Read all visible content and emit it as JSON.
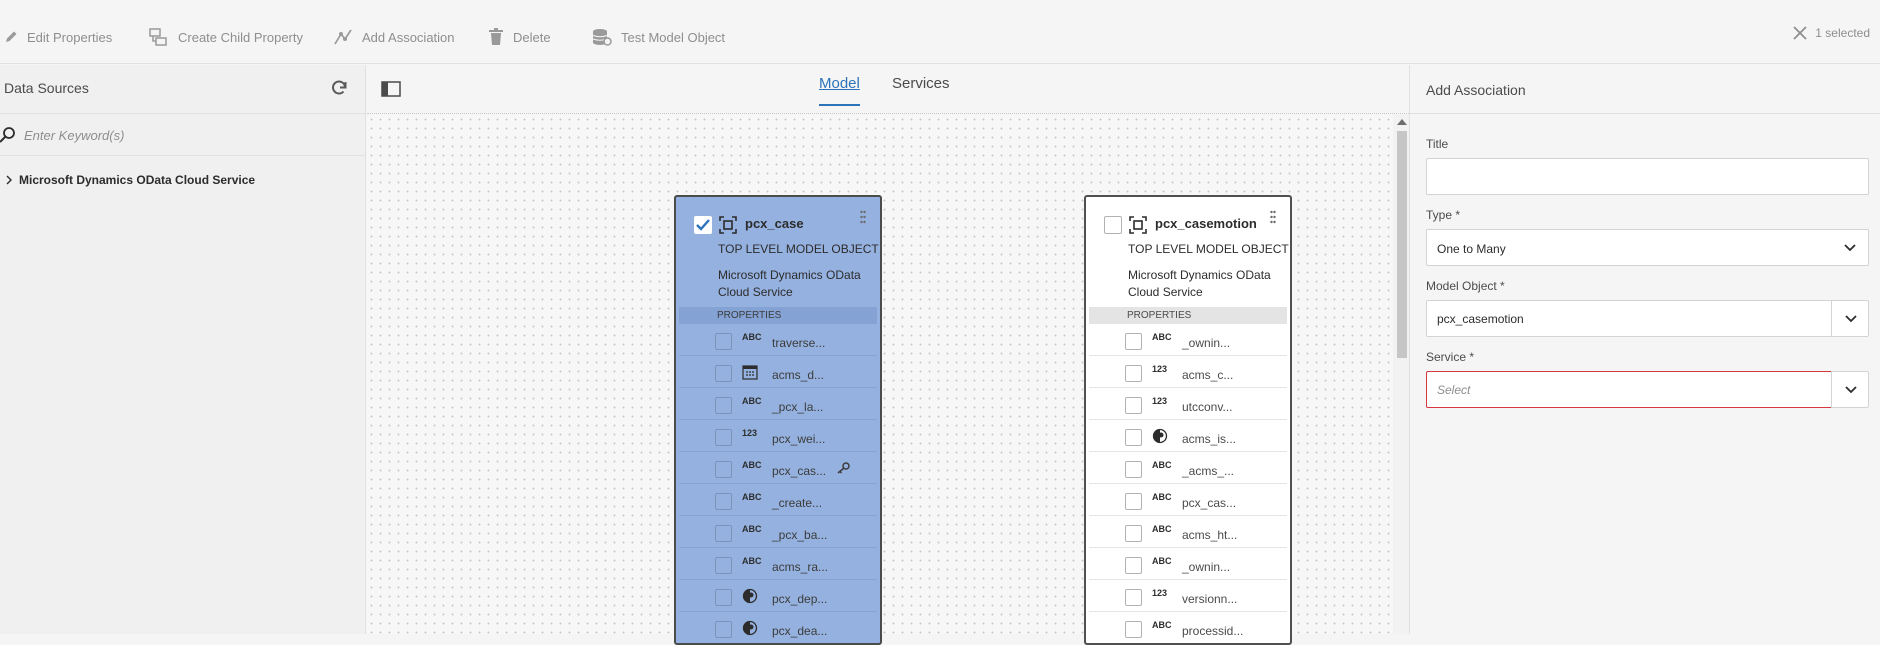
{
  "toolbar": {
    "edit_properties": "Edit Properties",
    "create_child_property": "Create Child Property",
    "add_association": "Add Association",
    "delete": "Delete",
    "test_model_object": "Test Model Object",
    "selection_count": "1 selected"
  },
  "left_rail": {
    "title": "Data Sources",
    "search_placeholder": "Enter Keyword(s)",
    "tree_item": "Microsoft Dynamics OData Cloud Service"
  },
  "center": {
    "tabs": [
      {
        "label": "Model",
        "active": true
      },
      {
        "label": "Services",
        "active": false
      }
    ]
  },
  "cards": [
    {
      "title": "pcx_case",
      "selected": true,
      "kind": "TOP LEVEL MODEL OBJECT",
      "source": "Microsoft Dynamics OData Cloud Service",
      "properties_header": "PROPERTIES",
      "properties": [
        {
          "type": "ABC",
          "name": "traverse..."
        },
        {
          "type": "calendar-icon",
          "name": "acms_d..."
        },
        {
          "type": "ABC",
          "name": "_pcx_la..."
        },
        {
          "type": "123",
          "name": "pcx_wei..."
        },
        {
          "type": "ABC",
          "name": "pcx_cas...",
          "key": true
        },
        {
          "type": "ABC",
          "name": "_create..."
        },
        {
          "type": "ABC",
          "name": "_pcx_ba..."
        },
        {
          "type": "ABC",
          "name": "acms_ra..."
        },
        {
          "type": "boolean-icon",
          "name": "pcx_dep..."
        },
        {
          "type": "boolean-icon",
          "name": "pcx_dea..."
        }
      ]
    },
    {
      "title": "pcx_casemotion",
      "selected": false,
      "kind": "TOP LEVEL MODEL OBJECT",
      "source": "Microsoft Dynamics OData Cloud Service",
      "properties_header": "PROPERTIES",
      "properties": [
        {
          "type": "ABC",
          "name": "_ownin..."
        },
        {
          "type": "123",
          "name": "acms_c..."
        },
        {
          "type": "123",
          "name": "utcconv..."
        },
        {
          "type": "boolean-icon",
          "name": "acms_is..."
        },
        {
          "type": "ABC",
          "name": "_acms_..."
        },
        {
          "type": "ABC",
          "name": "pcx_cas..."
        },
        {
          "type": "ABC",
          "name": "acms_ht..."
        },
        {
          "type": "ABC",
          "name": "_ownin..."
        },
        {
          "type": "123",
          "name": "versionn..."
        },
        {
          "type": "ABC",
          "name": "processid..."
        }
      ]
    }
  ],
  "add_association": {
    "title": "Add Association",
    "title_label": "Title",
    "title_value": "",
    "type_label": "Type *",
    "type_value": "One to Many",
    "model_object_label": "Model Object *",
    "model_object_value": "pcx_casemotion",
    "service_label": "Service *",
    "service_placeholder": "Select"
  },
  "colors": {
    "accent": "#2d73b9",
    "selected_card": "#95b1df",
    "error_border": "#d7373f"
  }
}
